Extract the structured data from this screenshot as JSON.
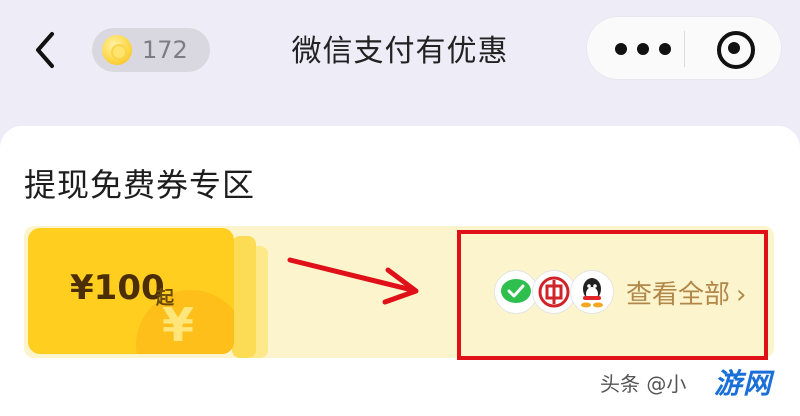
{
  "header": {
    "points_value": "172",
    "title": "微信支付有优惠"
  },
  "section": {
    "title": "提现免费券专区"
  },
  "banner": {
    "coupon_amount": "¥100",
    "coupon_suffix": "起",
    "coupon_symbol": "¥",
    "view_all": "查看全部",
    "chevron": "›"
  },
  "watermark": {
    "text": "头条 @小",
    "site": "游网"
  },
  "colors": {
    "accent_gold": "#ffce1f",
    "banner_bg": "#fcf4cc",
    "highlight_red": "#e01018",
    "link_gold": "#b1884a"
  }
}
